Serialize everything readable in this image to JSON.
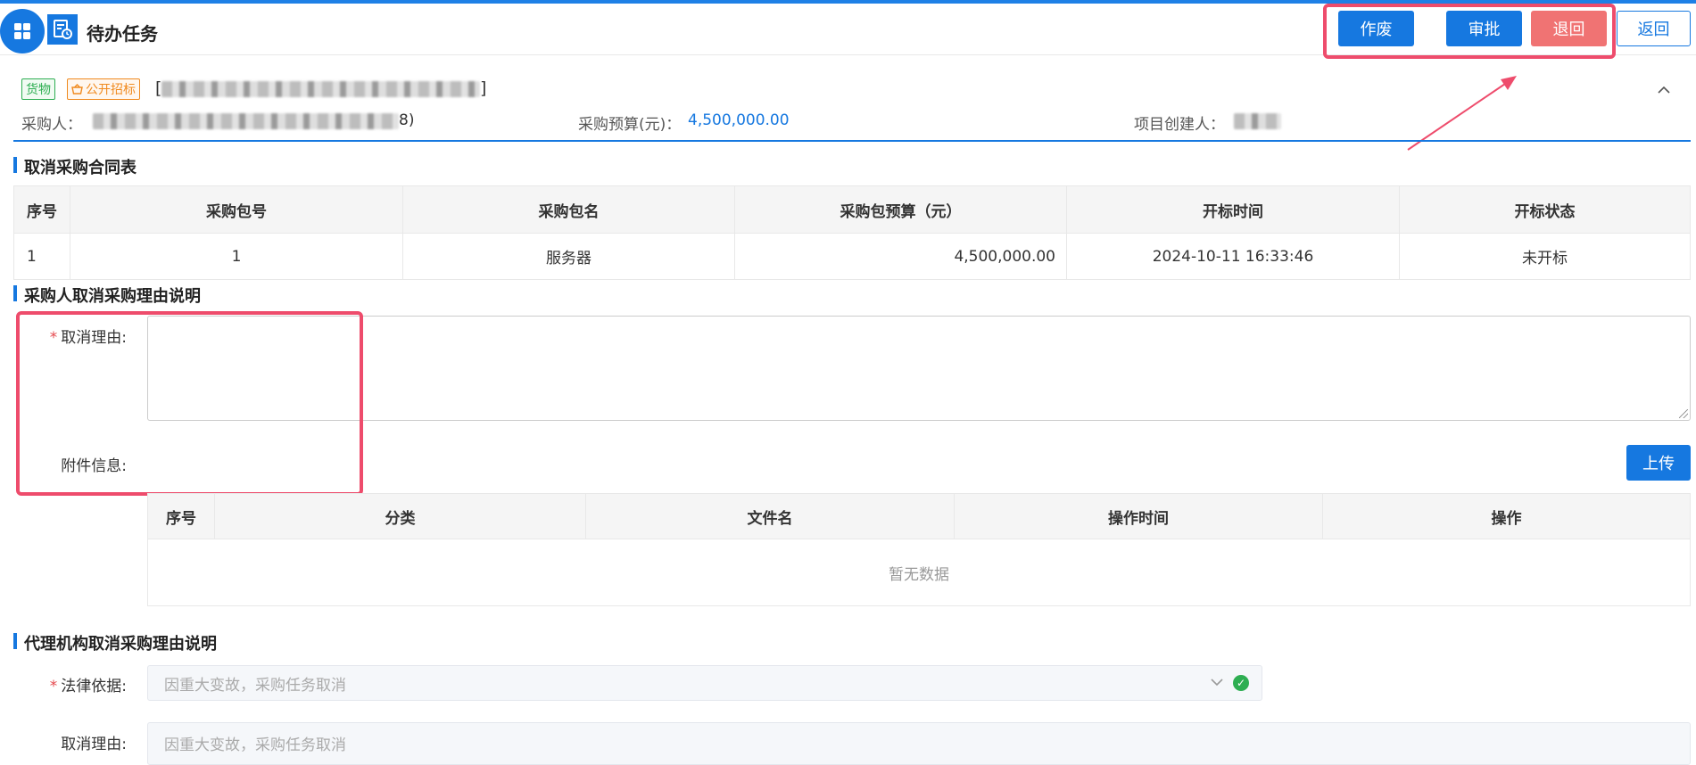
{
  "header": {
    "title": "待办任务",
    "buttons": {
      "void": "作废",
      "approve": "审批",
      "return": "退回",
      "back": "返回"
    }
  },
  "project": {
    "tags": [
      "货物",
      "公开招标"
    ],
    "title_suffix": "]",
    "buyer_label": "采购人：",
    "buyer_suffix": "8)",
    "budget_label": "采购预算(元)：",
    "budget_value": "4,500,000.00",
    "creator_label": "项目创建人："
  },
  "cancel_table": {
    "title": "取消采购合同表",
    "columns": [
      "序号",
      "采购包号",
      "采购包名",
      "采购包预算（元）",
      "开标时间",
      "开标状态"
    ],
    "rows": [
      [
        "1",
        "1",
        "服务器",
        "4,500,000.00",
        "2024-10-11 16:33:46",
        "未开标"
      ]
    ]
  },
  "buyer_reason": {
    "title": "采购人取消采购理由说明",
    "reason_label": "取消理由:",
    "attachment_label": "附件信息:",
    "upload_label": "上传",
    "attach_columns": [
      "序号",
      "分类",
      "文件名",
      "操作时间",
      "操作"
    ],
    "empty_text": "暂无数据"
  },
  "agency_reason": {
    "title": "代理机构取消采购理由说明",
    "legal_label": "法律依据:",
    "legal_value": "因重大变故，采购任务取消",
    "reason_label": "取消理由:",
    "reason_value": "因重大变故，采购任务取消"
  },
  "colors": {
    "primary": "#1678e0",
    "danger": "#f07373",
    "highlight": "#ee4c6c",
    "success": "#2eae52"
  }
}
